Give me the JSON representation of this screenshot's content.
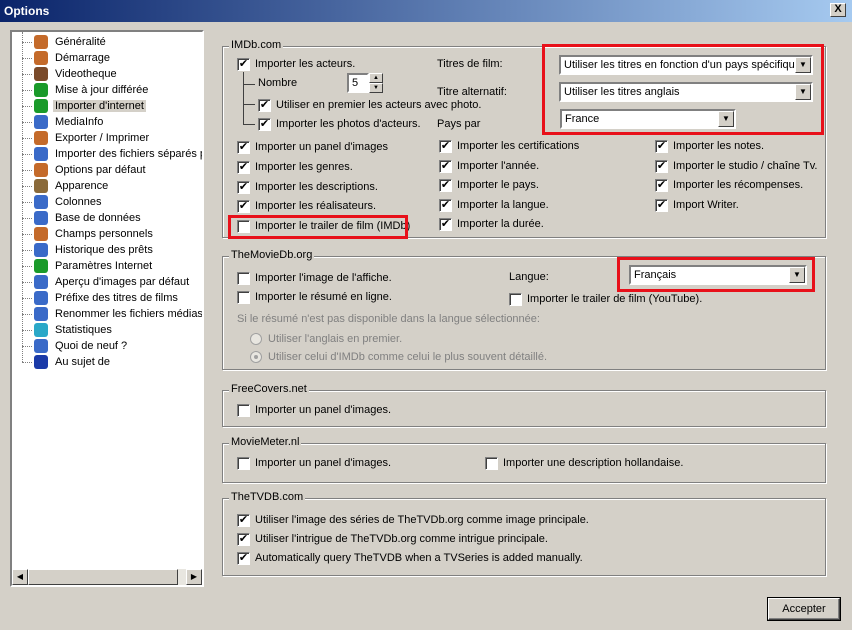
{
  "window": {
    "title": "Options",
    "close_glyph": "X"
  },
  "sidebar": {
    "items": [
      {
        "label": "Généralité",
        "icon": "user-icon",
        "color": "#c46a2a"
      },
      {
        "label": "Démarrage",
        "icon": "user-icon",
        "color": "#c46a2a"
      },
      {
        "label": "Videotheque",
        "icon": "film-icon",
        "color": "#7a4a2a"
      },
      {
        "label": "Mise à jour différée",
        "icon": "globe-icon",
        "color": "#1a9a2a"
      },
      {
        "label": "Importer d'internet",
        "icon": "globe-icon",
        "color": "#1a9a2a"
      },
      {
        "label": "MediaInfo",
        "icon": "gear-icon",
        "color": "#3a6ac8"
      },
      {
        "label": "Exporter / Imprimer",
        "icon": "export-icon",
        "color": "#c46a2a"
      },
      {
        "label": "Importer des fichiers séparés p",
        "icon": "import-icon",
        "color": "#3a6ac8"
      },
      {
        "label": "Options par défaut",
        "icon": "user-icon",
        "color": "#c46a2a"
      },
      {
        "label": "Apparence",
        "icon": "brush-icon",
        "color": "#8a6a3a"
      },
      {
        "label": "Colonnes",
        "icon": "windows-icon",
        "color": "#3a6ac8"
      },
      {
        "label": "Base de données",
        "icon": "windows-icon",
        "color": "#3a6ac8"
      },
      {
        "label": "Champs personnels",
        "icon": "user-icon",
        "color": "#c46a2a"
      },
      {
        "label": "Historique des prêts",
        "icon": "gear-icon",
        "color": "#3a6ac8"
      },
      {
        "label": "Paramètres Internet",
        "icon": "globe-icon",
        "color": "#1a9a2a"
      },
      {
        "label": "Aperçu d'images par défaut",
        "icon": "user-icon",
        "color": "#3a6ac8"
      },
      {
        "label": "Préfixe des titres de films",
        "icon": "windows-icon",
        "color": "#3a6ac8"
      },
      {
        "label": "Renommer les fichiers médias",
        "icon": "disk-icon",
        "color": "#3a6ac8"
      },
      {
        "label": "Statistiques",
        "icon": "pie-chart-icon",
        "color": "#2aa8c8"
      },
      {
        "label": "Quoi de neuf ?",
        "icon": "gear-icon",
        "color": "#3a6ac8"
      },
      {
        "label": "Au sujet de",
        "icon": "info-icon",
        "color": "#1a3aa8"
      }
    ],
    "selected_index": 4
  },
  "imdb": {
    "group_label": "IMDb.com",
    "import_actors": "Importer les acteurs.",
    "number_label": "Nombre",
    "number_value": "5",
    "actors_with_photo_first": "Utiliser en premier les acteurs avec photo.",
    "import_actor_photos": "Importer les photos d'acteurs.",
    "film_titles_label": "Titres de film:",
    "film_titles_value": "Utiliser les titres en fonction d'un pays spécifique",
    "alt_title_label": "Titre alternatif:",
    "alt_title_value": "Utiliser les titres anglais",
    "country_label": "Pays par",
    "country_value": "France",
    "col1": [
      "Importer un panel d'images",
      "Importer les genres.",
      "Importer les descriptions.",
      "Importer les réalisateurs.",
      "Importer le trailer de film (IMDb)"
    ],
    "col2": [
      "Importer les certifications",
      "Importer l'année.",
      "Importer le pays.",
      "Importer la langue.",
      "Importer la durée."
    ],
    "col3": [
      "Importer les notes.",
      "Importer le studio / chaîne Tv.",
      "Importer les récompenses.",
      "Import Writer."
    ]
  },
  "tmdb": {
    "group_label": "TheMovieDb.org",
    "import_poster": "Importer l'image de l'affiche.",
    "import_summary": "Importer le résumé en ligne.",
    "language_label": "Langue:",
    "language_value": "Français",
    "import_trailer": "Importer le trailer de film (YouTube).",
    "fallback_note": "Si le résumé n'est pas disponible dans la langue sélectionnée:",
    "radio_english": "Utiliser l'anglais en premier.",
    "radio_imdb": "Utiliser celui d'IMDb comme celui le plus souvent détaillé."
  },
  "freecovers": {
    "group_label": "FreeCovers.net",
    "import_panel": "Importer un panel d'images."
  },
  "moviemeter": {
    "group_label": "MovieMeter.nl",
    "import_panel": "Importer un panel d'images.",
    "import_dutch": "Importer une description hollandaise."
  },
  "tvdb": {
    "group_label": "TheTVDB.com",
    "opt1": "Utiliser l'image des séries de TheTVDb.org comme image principale.",
    "opt2": "Utiliser l'intrigue de TheTVDb.org comme intrigue principale.",
    "opt3": "Automatically query TheTVDB when a TVSeries is added manually."
  },
  "footer": {
    "accept_label": "Accepter"
  },
  "checkmark": "✔",
  "colors": {
    "highlight": "#e8101a",
    "title_bar": "#0a246a",
    "dialog_bg": "#d4d0c8"
  }
}
